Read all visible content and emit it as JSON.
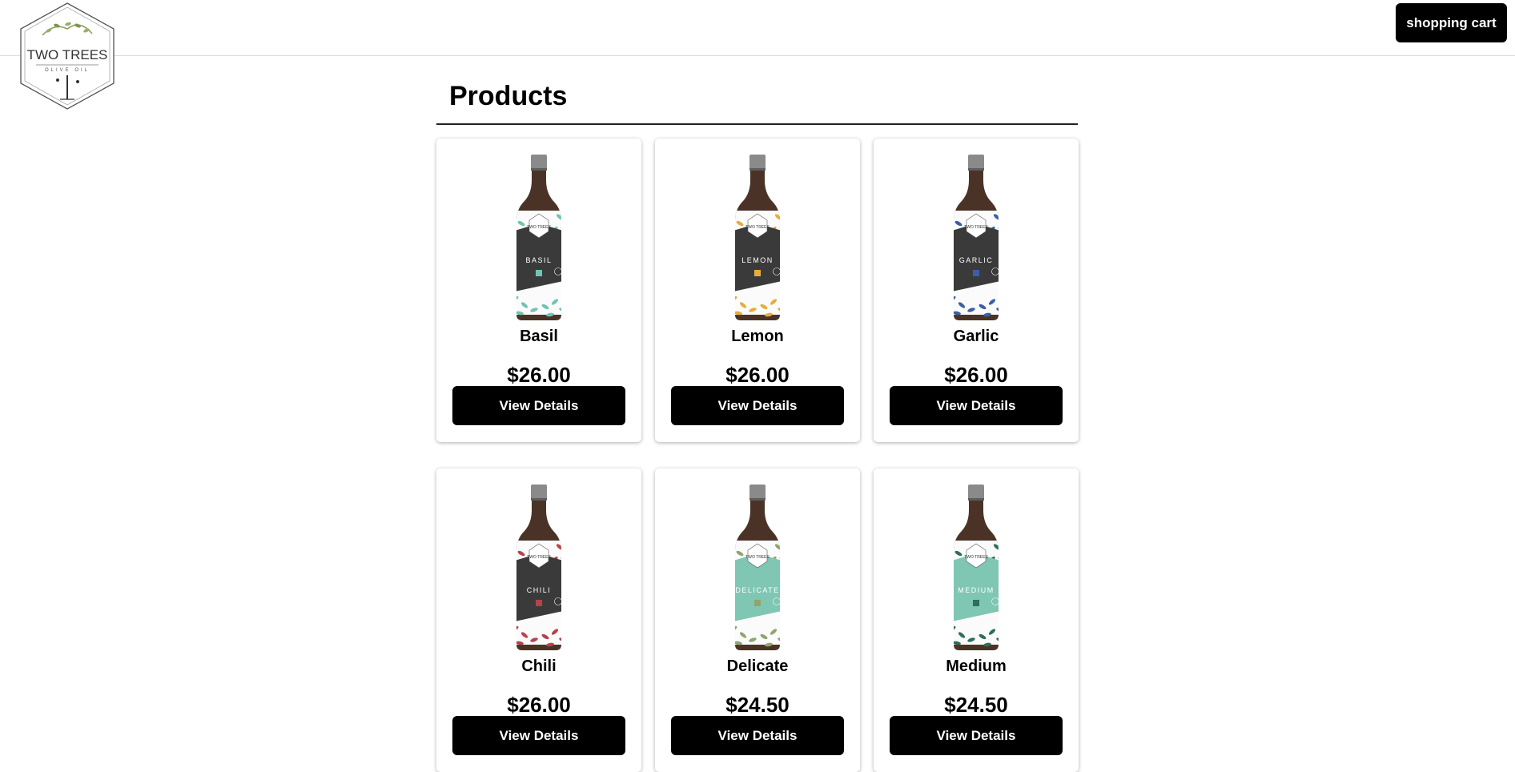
{
  "header": {
    "logo": {
      "line1": "TWO TREES",
      "line2": "OLIVE OIL"
    },
    "cart_label": "shopping cart"
  },
  "main": {
    "title": "Products",
    "products": [
      {
        "name": "Basil",
        "price": "$26.00",
        "button": "View Details",
        "label_text": "BASIL",
        "accent_color": "#6fc4b4",
        "label_color": "#3b3a3b"
      },
      {
        "name": "Lemon",
        "price": "$26.00",
        "button": "View Details",
        "label_text": "LEMON",
        "accent_color": "#e7ad3c",
        "label_color": "#3b3a3b"
      },
      {
        "name": "Garlic",
        "price": "$26.00",
        "button": "View Details",
        "label_text": "GARLIC",
        "accent_color": "#3a5fa8",
        "label_color": "#3b3a3b"
      },
      {
        "name": "Chili",
        "price": "$26.00",
        "button": "View Details",
        "label_text": "CHILI",
        "accent_color": "#b9414c",
        "label_color": "#3b3a3b"
      },
      {
        "name": "Delicate",
        "price": "$24.50",
        "button": "View Details",
        "label_text": "DELICATE",
        "accent_color": "#8fa56e",
        "label_color": "#7fc6b3"
      },
      {
        "name": "Medium",
        "price": "$24.50",
        "button": "View Details",
        "label_text": "MEDIUM",
        "accent_color": "#2e6e5a",
        "label_color": "#7fc6b3"
      }
    ]
  },
  "colors": {
    "button_bg": "#000000",
    "button_text": "#ffffff",
    "bottle_glass": "#4a3326",
    "bottle_cap": "#8a8a8a"
  }
}
